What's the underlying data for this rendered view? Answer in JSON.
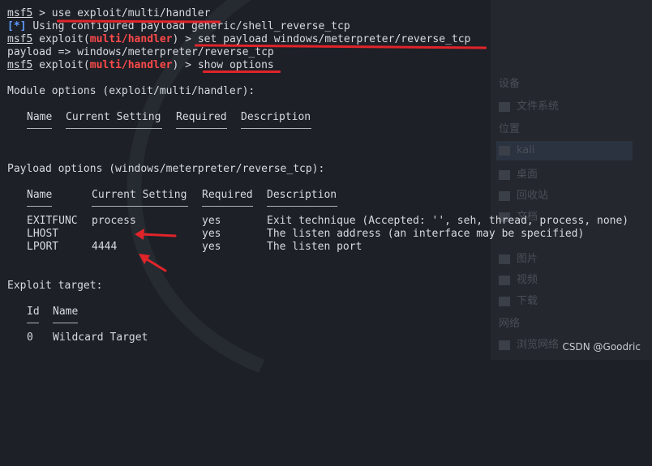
{
  "terminal": {
    "prompt": "msf5",
    "module": "multi/handler",
    "cmd1": "use exploit/multi/handler",
    "info_tag": "[*]",
    "info_msg": "Using configured payload generic/shell_reverse_tcp",
    "cmd2": "set payload windows/meterpreter/reverse_tcp",
    "payload_echo": "payload => windows/meterpreter/reverse_tcp",
    "cmd3": "show options",
    "module_options_title": "Module options (exploit/multi/handler):",
    "module_headers": [
      "Name",
      "Current Setting",
      "Required",
      "Description"
    ],
    "payload_options_title": "Payload options (windows/meterpreter/reverse_tcp):",
    "payload_headers": [
      "Name",
      "Current Setting",
      "Required",
      "Description"
    ],
    "payload_rows": [
      {
        "name": "EXITFUNC",
        "setting": "process",
        "required": "yes",
        "description": "Exit technique (Accepted: '', seh, thread, process, none)"
      },
      {
        "name": "LHOST",
        "setting": "",
        "required": "yes",
        "description": "The listen address (an interface may be specified)"
      },
      {
        "name": "LPORT",
        "setting": "4444",
        "required": "yes",
        "description": "The listen port"
      }
    ],
    "exploit_target_title": "Exploit target:",
    "target_headers": [
      "Id",
      "Name"
    ],
    "target_rows": [
      {
        "id": "0",
        "name": "Wildcard Target"
      }
    ]
  },
  "background_sidebar": {
    "items": [
      "设备",
      "文件系统",
      "位置",
      "kali",
      "桌面",
      "回收站",
      "文档",
      "图片",
      "视频",
      "下载",
      "网络",
      "浏览网络"
    ]
  },
  "watermark": "CSDN @Goodric",
  "colors": {
    "background": "#1d2026",
    "prompt_red": "#ff4a4a",
    "info_blue": "#5f9dff",
    "annotation_red": "#e0242a"
  }
}
